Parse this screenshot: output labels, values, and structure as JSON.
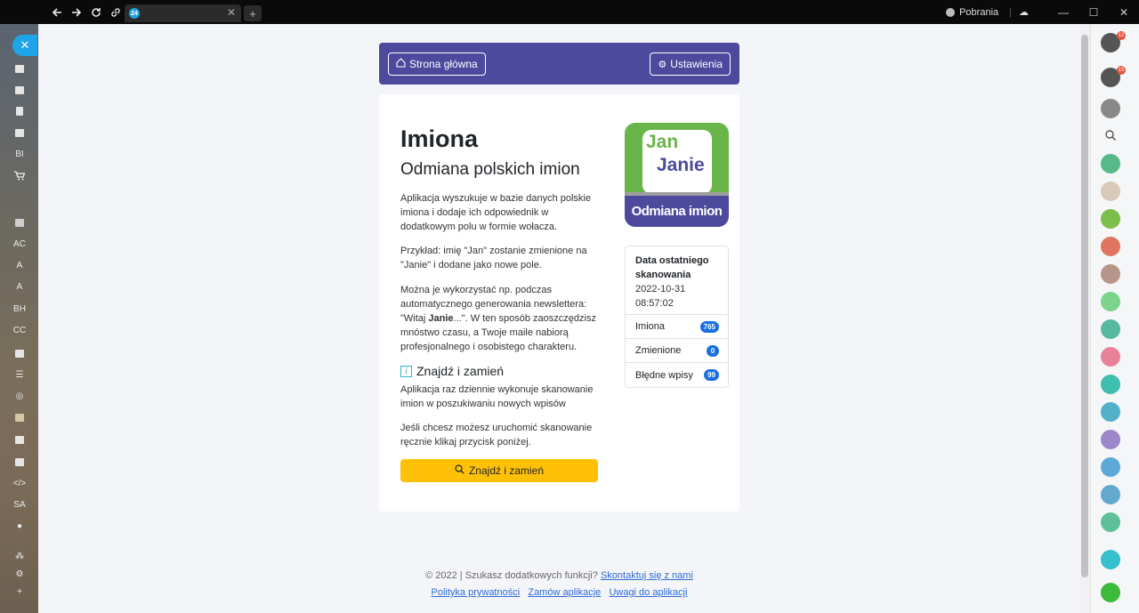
{
  "browser": {
    "tab_favicon": "24",
    "downloads_label": "Pobrania"
  },
  "sidebar_left": {
    "items": [
      "BI",
      "AC",
      "A",
      "A",
      "BH",
      "CC",
      "SA"
    ]
  },
  "right_bar": {
    "help_badge": "12",
    "notifications_badge": "15"
  },
  "nav": {
    "home": "Strona główna",
    "settings": "Ustawienia"
  },
  "main": {
    "title": "Imiona",
    "subtitle": "Odmiana polskich imion",
    "p1": "Aplikacja wyszukuje w bazie danych polskie imiona i dodaje ich odpowiednik w dodatkowym polu w formie wołacza.",
    "p2": "Przykład: imię \"Jan\" zostanie zmienione na \"Janie\" i dodane jako nowe pole.",
    "p3_before": "Można je wykorzystać np. podczas automatycznego generowania newslettera: \"Witaj ",
    "p3_bold": "Janie",
    "p3_after": "...\". W ten sposób zaoszczędzisz mnóstwo czasu, a Twoje maile nabiorą profesjonalnego i osobistego charakteru.",
    "section_title": "Znajdź i zamień",
    "p4": "Aplikacja raz dziennie wykonuje skanowanie imion w poszukiwaniu nowych wpisów",
    "p5": "Jeśli chcesz możesz uruchomić skanowanie ręcznie klikaj przycisk poniżej.",
    "button": "Znajdź i zamień"
  },
  "logo": {
    "line1": "Jan",
    "line2": "Janie",
    "bottom": "Odmiana imion"
  },
  "stats": {
    "scan_label": "Data ostatniego skanowania",
    "scan_date": "2022-10-31",
    "scan_time": "08:57:02",
    "rows": [
      {
        "label": "Imiona",
        "value": "765"
      },
      {
        "label": "Zmienione",
        "value": "0"
      },
      {
        "label": "Błędne wpisy",
        "value": "99"
      }
    ]
  },
  "footer": {
    "copyright": "© 2022 | Szukasz dodatkowych funkcji?",
    "contact": "Skontaktuj się z nami",
    "privacy": "Polityka prywatności",
    "order": "Zamów aplikacje",
    "feedback": "Uwagi do aplikacji"
  },
  "colors": {
    "brand": "#4d4a9d",
    "accent": "#ffc107",
    "badge": "#1a6fe0"
  }
}
